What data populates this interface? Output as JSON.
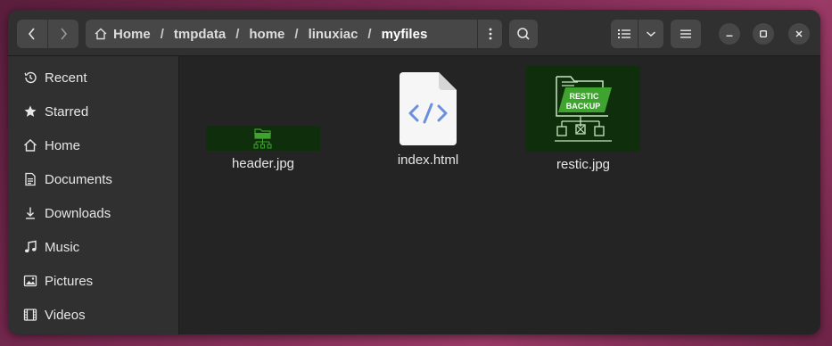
{
  "window": {
    "title": "myfiles"
  },
  "toolbar": {
    "back_icon": "chevron-left-icon",
    "forward_icon": "chevron-right-icon",
    "menu_icon": "vertical-dots-icon",
    "search_icon": "search-icon",
    "view_icon": "list-view-icon",
    "view_options_icon": "chevron-down-icon",
    "main_menu_icon": "hamburger-icon"
  },
  "breadcrumb": {
    "items": [
      "Home",
      "tmpdata",
      "home",
      "linuxiac",
      "myfiles"
    ],
    "separator": "/"
  },
  "window_controls": [
    "minimize",
    "maximize",
    "close"
  ],
  "sidebar": {
    "items": [
      {
        "label": "Recent",
        "icon": "clock-icon"
      },
      {
        "label": "Starred",
        "icon": "star-icon"
      },
      {
        "label": "Home",
        "icon": "home-icon"
      },
      {
        "label": "Documents",
        "icon": "document-icon"
      },
      {
        "label": "Downloads",
        "icon": "download-icon"
      },
      {
        "label": "Music",
        "icon": "music-note-icon"
      },
      {
        "label": "Pictures",
        "icon": "picture-icon"
      },
      {
        "label": "Videos",
        "icon": "film-icon"
      }
    ]
  },
  "files": [
    {
      "name": "header.jpg",
      "type": "image"
    },
    {
      "name": "index.html",
      "type": "html"
    },
    {
      "name": "restic.jpg",
      "type": "image",
      "thumbnail_text": [
        "RESTIC",
        "BACKUP"
      ]
    }
  ],
  "colors": {
    "window_bg": "#242424",
    "sidebar_bg": "#303030",
    "button_bg": "#474747",
    "thumb_green": "#0f2e0c",
    "accent_green": "#3fa32f",
    "html_icon_blue": "#6a8fdc"
  }
}
